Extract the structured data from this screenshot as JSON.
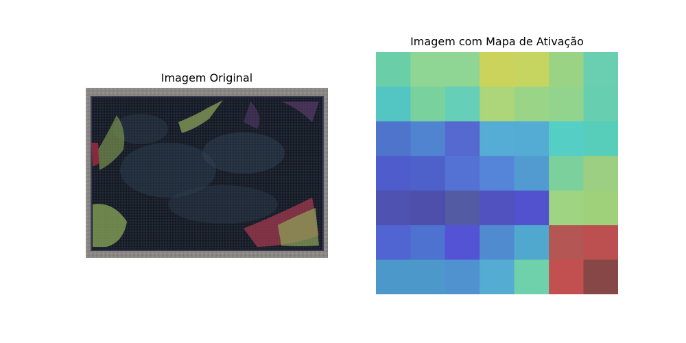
{
  "titles": {
    "left": "Imagem Original",
    "right": "Imagem com Mapa de Ativação"
  },
  "heatmap": {
    "rows": 7,
    "cols": 7,
    "cells": [
      [
        "#6acfa8",
        "#8fd593",
        "#8fd593",
        "#cbd35c",
        "#c6d560",
        "#9bd385",
        "#69cfb0"
      ],
      [
        "#53c6c3",
        "#79d29e",
        "#65cfb8",
        "#add57a",
        "#9ad487",
        "#92d48e",
        "#67cfb0"
      ],
      [
        "#4f74cb",
        "#5184d0",
        "#5569d0",
        "#55acd5",
        "#54acd5",
        "#55cfc6",
        "#57ceba"
      ],
      [
        "#4f5ccc",
        "#4e61ca",
        "#5472d4",
        "#5585d8",
        "#519bd1",
        "#7cd09c",
        "#9ccf81"
      ],
      [
        "#4f52b0",
        "#4e4eab",
        "#535ba3",
        "#5251c0",
        "#5252cf",
        "#9ed482",
        "#9fd17a"
      ],
      [
        "#5065d2",
        "#4d72cf",
        "#5453d6",
        "#508bd0",
        "#51a8cf",
        "#b35654",
        "#bc5050"
      ],
      [
        "#4c98cb",
        "#4d98cb",
        "#5092d0",
        "#54acd2",
        "#6fd1ab",
        "#c35050",
        "#884747"
      ]
    ]
  }
}
